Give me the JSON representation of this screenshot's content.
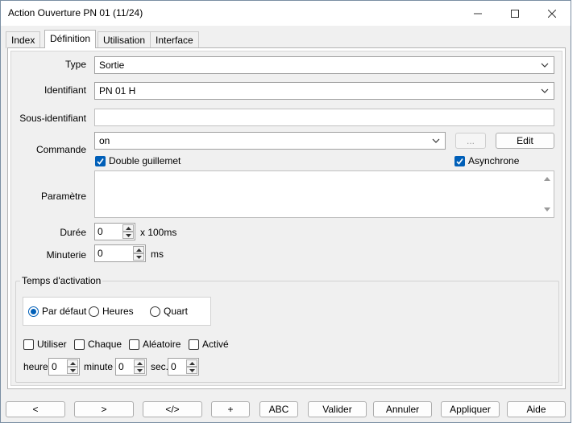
{
  "window": {
    "title": "Action Ouverture PN 01 (11/24)",
    "accent": "#005fb8"
  },
  "tabs": [
    {
      "label": "Index",
      "active": false
    },
    {
      "label": "Définition",
      "active": true
    },
    {
      "label": "Utilisation",
      "active": false
    },
    {
      "label": "Interface",
      "active": false
    }
  ],
  "form": {
    "type_label": "Type",
    "type_value": "Sortie",
    "identifiant_label": "Identifiant",
    "identifiant_value": "PN 01 H",
    "sous_identifiant_label": "Sous-identifiant",
    "sous_identifiant_value": "",
    "commande_label": "Commande",
    "commande_value": "on",
    "browse_label": "...",
    "edit_label": "Edit",
    "double_guillemet_label": "Double guillemet",
    "double_guillemet_checked": true,
    "asynchrone_label": "Asynchrone",
    "asynchrone_checked": true,
    "parametre_label": "Paramètre",
    "parametre_value": "",
    "duree_label": "Durée",
    "duree_value": "0",
    "duree_unit": "x 100ms",
    "minuterie_label": "Minuterie",
    "minuterie_value": "0",
    "minuterie_unit": "ms"
  },
  "activation": {
    "title": "Temps d'activation",
    "radios": [
      {
        "label": "Par défaut",
        "selected": true
      },
      {
        "label": "Heures",
        "selected": false
      },
      {
        "label": "Quart",
        "selected": false
      }
    ],
    "checks": [
      {
        "label": "Utiliser",
        "checked": false
      },
      {
        "label": "Chaque",
        "checked": false
      },
      {
        "label": "Aléatoire",
        "checked": false
      },
      {
        "label": "Activé",
        "checked": false
      }
    ],
    "heure_label": "heure",
    "heure_value": "0",
    "minute_label": "minute",
    "minute_value": "0",
    "sec_label": "sec.",
    "sec_value": "0"
  },
  "buttons": {
    "prev": "<",
    "next": ">",
    "code": "</>",
    "add": "+",
    "abc": "ABC",
    "valider": "Valider",
    "annuler": "Annuler",
    "appliquer": "Appliquer",
    "aide": "Aide"
  }
}
